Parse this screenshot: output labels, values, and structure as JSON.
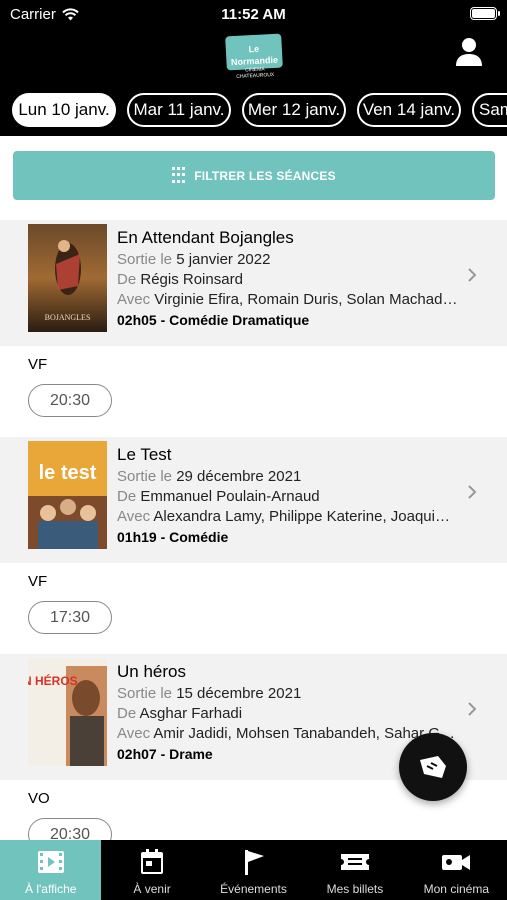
{
  "status_bar": {
    "carrier": "Carrier",
    "time": "11:52 AM"
  },
  "header": {
    "logo_text": "Le Normandie",
    "logo_sub": "CINEMA CHATEAUROUX"
  },
  "dates": [
    {
      "label": "Lun 10 janv.",
      "active": true
    },
    {
      "label": "Mar 11 janv.",
      "active": false
    },
    {
      "label": "Mer 12 janv.",
      "active": false
    },
    {
      "label": "Ven 14 janv.",
      "active": false
    },
    {
      "label": "Sam",
      "active": false
    }
  ],
  "filter": {
    "label": "FILTRER LES SÉANCES"
  },
  "films": [
    {
      "title": "En Attendant Bojangles",
      "release_label": "Sortie le",
      "release_date": "5 janvier 2022",
      "director_label": "De",
      "director": "Régis Roinsard",
      "cast_label": "Avec",
      "cast": "Virginie Efira, Romain Duris, Solan Machado-Graner",
      "meta": "02h05 - Comédie Dramatique",
      "poster_text": "BOJANGLES",
      "version": "VF",
      "seances": [
        "20:30"
      ]
    },
    {
      "title": "Le Test",
      "release_label": "Sortie le",
      "release_date": "29 décembre 2021",
      "director_label": "De",
      "director": "Emmanuel Poulain-Arnaud",
      "cast_label": "Avec",
      "cast": "Alexandra Lamy, Philippe Katerine, Joaquim Fossi",
      "meta": "01h19 - Comédie",
      "poster_text": "le test",
      "version": "VF",
      "seances": [
        "17:30"
      ]
    },
    {
      "title": "Un héros",
      "release_label": "Sortie le",
      "release_date": "15 décembre 2021",
      "director_label": "De",
      "director": "Asghar Farhadi",
      "cast_label": "Avec",
      "cast": "Amir Jadidi, Mohsen Tanabandeh, Sahar Goldust",
      "meta": "02h07 - Drame",
      "poster_text": "UN HÉROS",
      "version": "VO",
      "seances": [
        "20:30"
      ]
    }
  ],
  "tabs": [
    {
      "label": "À l'affiche",
      "icon": "film-icon",
      "active": true
    },
    {
      "label": "À venir",
      "icon": "calendar-icon",
      "active": false
    },
    {
      "label": "Événements",
      "icon": "flag-icon",
      "active": false
    },
    {
      "label": "Mes billets",
      "icon": "ticket-icon",
      "active": false
    },
    {
      "label": "Mon cinéma",
      "icon": "camera-icon",
      "active": false
    }
  ],
  "colors": {
    "accent": "#71c4bd",
    "header_bg": "#000000",
    "film_bg": "#f2f2f2"
  }
}
